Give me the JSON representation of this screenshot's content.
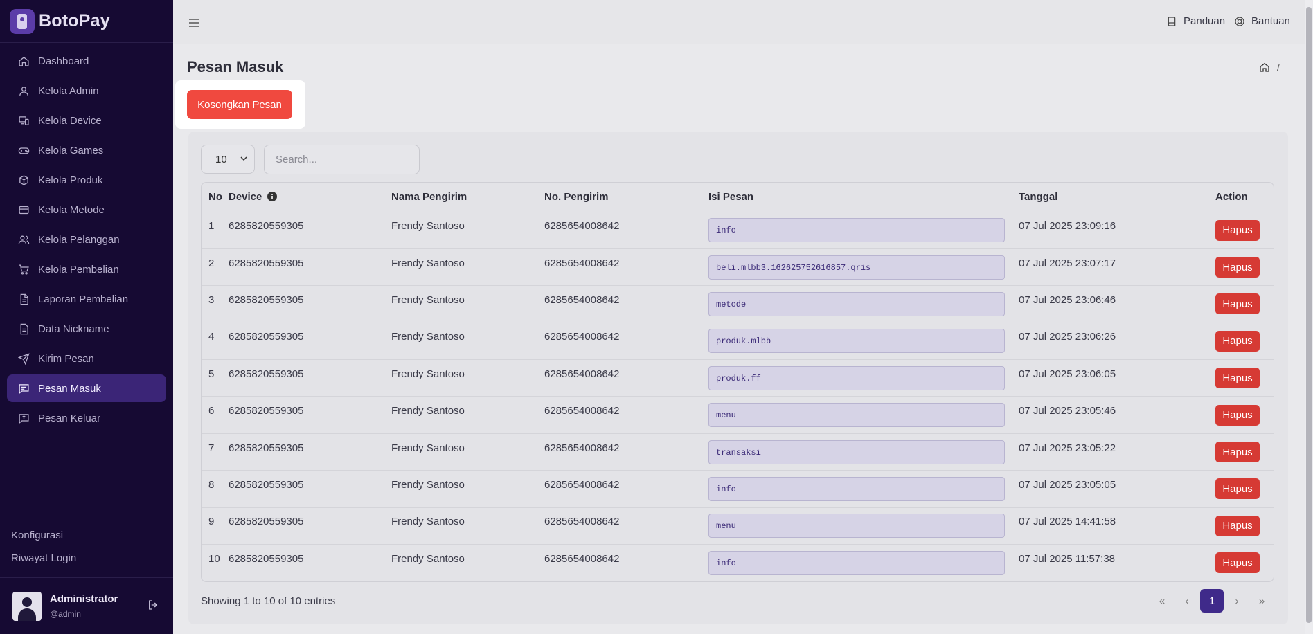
{
  "brand": {
    "name": "BotoPay"
  },
  "sidebar": {
    "items": [
      {
        "label": "Dashboard",
        "icon": "home-icon"
      },
      {
        "label": "Kelola Admin",
        "icon": "user-icon"
      },
      {
        "label": "Kelola Device",
        "icon": "devices-icon"
      },
      {
        "label": "Kelola Games",
        "icon": "gamepad-icon"
      },
      {
        "label": "Kelola Produk",
        "icon": "box-icon"
      },
      {
        "label": "Kelola Metode",
        "icon": "credit-card-icon"
      },
      {
        "label": "Kelola Pelanggan",
        "icon": "users-icon"
      },
      {
        "label": "Kelola Pembelian",
        "icon": "cart-icon"
      },
      {
        "label": "Laporan Pembelian",
        "icon": "report-icon"
      },
      {
        "label": "Data Nickname",
        "icon": "document-icon"
      },
      {
        "label": "Kirim Pesan",
        "icon": "send-icon"
      },
      {
        "label": "Pesan Masuk",
        "icon": "inbox-message-icon",
        "active": true
      },
      {
        "label": "Pesan Keluar",
        "icon": "outbox-message-icon"
      }
    ],
    "footer_links": [
      "Konfigurasi",
      "Riwayat Login"
    ],
    "user": {
      "name": "Administrator",
      "handle": "@admin"
    }
  },
  "topbar": {
    "guide": "Panduan",
    "help": "Bantuan"
  },
  "page": {
    "title": "Pesan Masuk",
    "breadcrumb_sep": "/"
  },
  "actions": {
    "empty_label": "Kosongkan Pesan"
  },
  "table_controls": {
    "page_length": "10",
    "search_placeholder": "Search..."
  },
  "table": {
    "columns": [
      "No",
      "Device",
      "Nama Pengirim",
      "No. Pengirim",
      "Isi Pesan",
      "Tanggal",
      "Action"
    ],
    "rows": [
      {
        "no": "1",
        "device": "6285820559305",
        "nama": "Frendy Santoso",
        "nomor": "6285654008642",
        "isi": "info",
        "tanggal": "07 Jul 2025 23:09:16",
        "action": "Hapus"
      },
      {
        "no": "2",
        "device": "6285820559305",
        "nama": "Frendy Santoso",
        "nomor": "6285654008642",
        "isi": "beli.mlbb3.162625752616857.qris",
        "tanggal": "07 Jul 2025 23:07:17",
        "action": "Hapus"
      },
      {
        "no": "3",
        "device": "6285820559305",
        "nama": "Frendy Santoso",
        "nomor": "6285654008642",
        "isi": "metode",
        "tanggal": "07 Jul 2025 23:06:46",
        "action": "Hapus"
      },
      {
        "no": "4",
        "device": "6285820559305",
        "nama": "Frendy Santoso",
        "nomor": "6285654008642",
        "isi": "produk.mlbb",
        "tanggal": "07 Jul 2025 23:06:26",
        "action": "Hapus"
      },
      {
        "no": "5",
        "device": "6285820559305",
        "nama": "Frendy Santoso",
        "nomor": "6285654008642",
        "isi": "produk.ff",
        "tanggal": "07 Jul 2025 23:06:05",
        "action": "Hapus"
      },
      {
        "no": "6",
        "device": "6285820559305",
        "nama": "Frendy Santoso",
        "nomor": "6285654008642",
        "isi": "menu",
        "tanggal": "07 Jul 2025 23:05:46",
        "action": "Hapus"
      },
      {
        "no": "7",
        "device": "6285820559305",
        "nama": "Frendy Santoso",
        "nomor": "6285654008642",
        "isi": "transaksi",
        "tanggal": "07 Jul 2025 23:05:22",
        "action": "Hapus"
      },
      {
        "no": "8",
        "device": "6285820559305",
        "nama": "Frendy Santoso",
        "nomor": "6285654008642",
        "isi": "info",
        "tanggal": "07 Jul 2025 23:05:05",
        "action": "Hapus"
      },
      {
        "no": "9",
        "device": "6285820559305",
        "nama": "Frendy Santoso",
        "nomor": "6285654008642",
        "isi": "menu",
        "tanggal": "07 Jul 2025 14:41:58",
        "action": "Hapus"
      },
      {
        "no": "10",
        "device": "6285820559305",
        "nama": "Frendy Santoso",
        "nomor": "6285654008642",
        "isi": "info",
        "tanggal": "07 Jul 2025 11:57:38",
        "action": "Hapus"
      }
    ]
  },
  "footer": {
    "entries": "Showing 1 to 10 of 10 entries",
    "pagination": {
      "first": "«",
      "prev": "‹",
      "current": "1",
      "next": "›",
      "last": "»"
    }
  },
  "colors": {
    "sidebar_bg": "#160a33",
    "active_item": "#3b2577",
    "danger": "#d63a34",
    "empty_button": "#f0493f",
    "pager_active": "#3f2a8a"
  }
}
